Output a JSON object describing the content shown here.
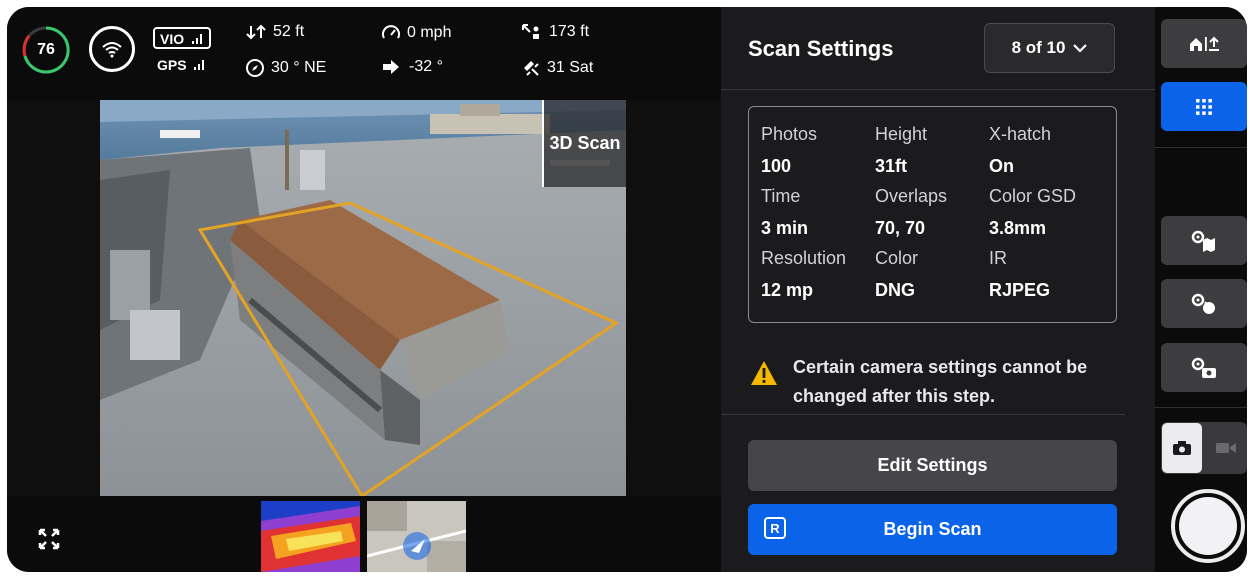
{
  "telemetry": {
    "battery": "76",
    "vio_label": "VIO",
    "gps_label": "GPS",
    "altitude": "52 ft",
    "heading": "30 ° NE",
    "speed": "0 mph",
    "vertical_speed": "-32 °",
    "distance": "173 ft",
    "satellites": "31 Sat"
  },
  "camera": {
    "overlay_label": "3D Scan"
  },
  "panel": {
    "title": "Scan Settings",
    "step": "8 of 10",
    "stats": [
      {
        "label": "Photos",
        "value": "100"
      },
      {
        "label": "Height",
        "value": "31ft"
      },
      {
        "label": "X-hatch",
        "value": "On"
      },
      {
        "label": "Time",
        "value": "3 min"
      },
      {
        "label": "Overlaps",
        "value": "70, 70"
      },
      {
        "label": "Color GSD",
        "value": "3.8mm"
      },
      {
        "label": "Resolution",
        "value": "12 mp"
      },
      {
        "label": "Color",
        "value": "DNG"
      },
      {
        "label": "IR",
        "value": "RJPEG"
      }
    ],
    "warning": "Certain camera settings cannot be changed after this step.",
    "edit_button": "Edit Settings",
    "begin_button": "Begin Scan",
    "begin_key": "R"
  },
  "rail": {
    "icons": [
      "home-return-icon",
      "grid-icon",
      "settings-map-icon",
      "settings-drone-icon",
      "settings-camera-icon",
      "photo-mode-icon",
      "video-mode-icon",
      "shutter-button"
    ]
  },
  "colors": {
    "accent": "#0a63e8",
    "warning": "#f5b800",
    "battery_ring": "#3ac66b",
    "scan_outline": "#e3a325"
  }
}
